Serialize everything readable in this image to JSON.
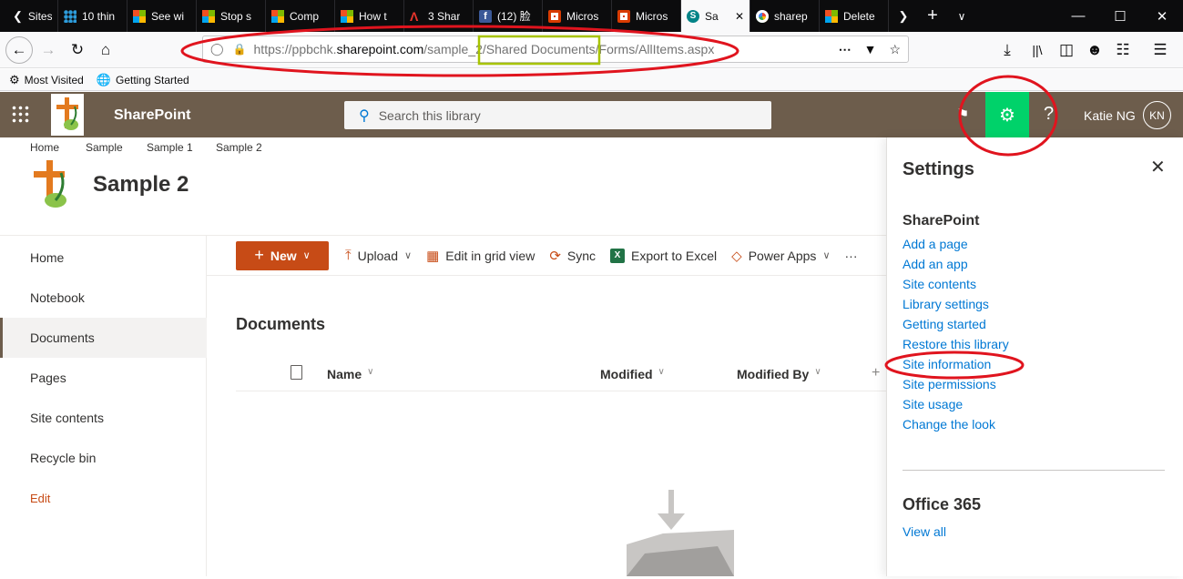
{
  "browser": {
    "tabs": [
      {
        "label": "Sites v",
        "icon": "back-chevron-icon"
      },
      {
        "label": "10 thin",
        "icon": "grid-favicon-icon"
      },
      {
        "label": "See wi",
        "icon": "microsoft-logo-icon"
      },
      {
        "label": "Stop s",
        "icon": "microsoft-logo-icon"
      },
      {
        "label": "Comp",
        "icon": "microsoft-logo-icon"
      },
      {
        "label": "How t",
        "icon": "microsoft-logo-icon"
      },
      {
        "label": "3 Shar",
        "icon": "red-a-logo-icon"
      },
      {
        "label": "(12) 脸",
        "icon": "facebook-icon"
      },
      {
        "label": "Micros",
        "icon": "office-logo-icon"
      },
      {
        "label": "Micros",
        "icon": "office-logo-icon"
      },
      {
        "label": "Sa",
        "icon": "sharepoint-logo-icon",
        "active": true
      },
      {
        "label": "sharep",
        "icon": "google-logo-icon"
      },
      {
        "label": "Delete",
        "icon": "microsoft-logo-icon"
      }
    ],
    "url": {
      "prefix": "https://ppbchk.",
      "host": "sharepoint.com",
      "path_a": "/sample_",
      "path_b": "2/Shared Documents",
      "path_c": "/Forms/AllItems.aspx"
    },
    "bookmarks": [
      {
        "label": "Most Visited"
      },
      {
        "label": "Getting Started"
      }
    ],
    "accent_colors": {
      "annotation_red": "#e0141e",
      "annotation_green": "#a8c400"
    }
  },
  "suite": {
    "app_name": "SharePoint",
    "search_placeholder": "Search this library",
    "user_name": "Katie NG",
    "avatar_initials": "KN",
    "bar_color": "#6d5d4c",
    "gear_highlight": "#00d26a"
  },
  "breadcrumb": [
    "Home",
    "Sample",
    "Sample 1",
    "Sample 2"
  ],
  "site_title": "Sample 2",
  "left_nav": [
    {
      "label": "Home"
    },
    {
      "label": "Notebook"
    },
    {
      "label": "Documents",
      "selected": true
    },
    {
      "label": "Pages"
    },
    {
      "label": "Site contents"
    },
    {
      "label": "Recycle bin"
    },
    {
      "label": "Edit"
    }
  ],
  "command_bar": {
    "new": "New",
    "upload": "Upload",
    "grid": "Edit in grid view",
    "sync": "Sync",
    "export": "Export to Excel",
    "power_apps": "Power Apps",
    "more": "···"
  },
  "library": {
    "heading": "Documents",
    "columns": [
      "Name",
      "Modified",
      "Modified By"
    ],
    "add_column": "+"
  },
  "settings": {
    "title": "Settings",
    "sharepoint_heading": "SharePoint",
    "links": [
      "Add a page",
      "Add an app",
      "Site contents",
      "Library settings",
      "Getting started",
      "Restore this library",
      "Site information",
      "Site permissions",
      "Site usage",
      "Change the look"
    ],
    "office_heading": "Office 365",
    "view_all": "View all"
  }
}
